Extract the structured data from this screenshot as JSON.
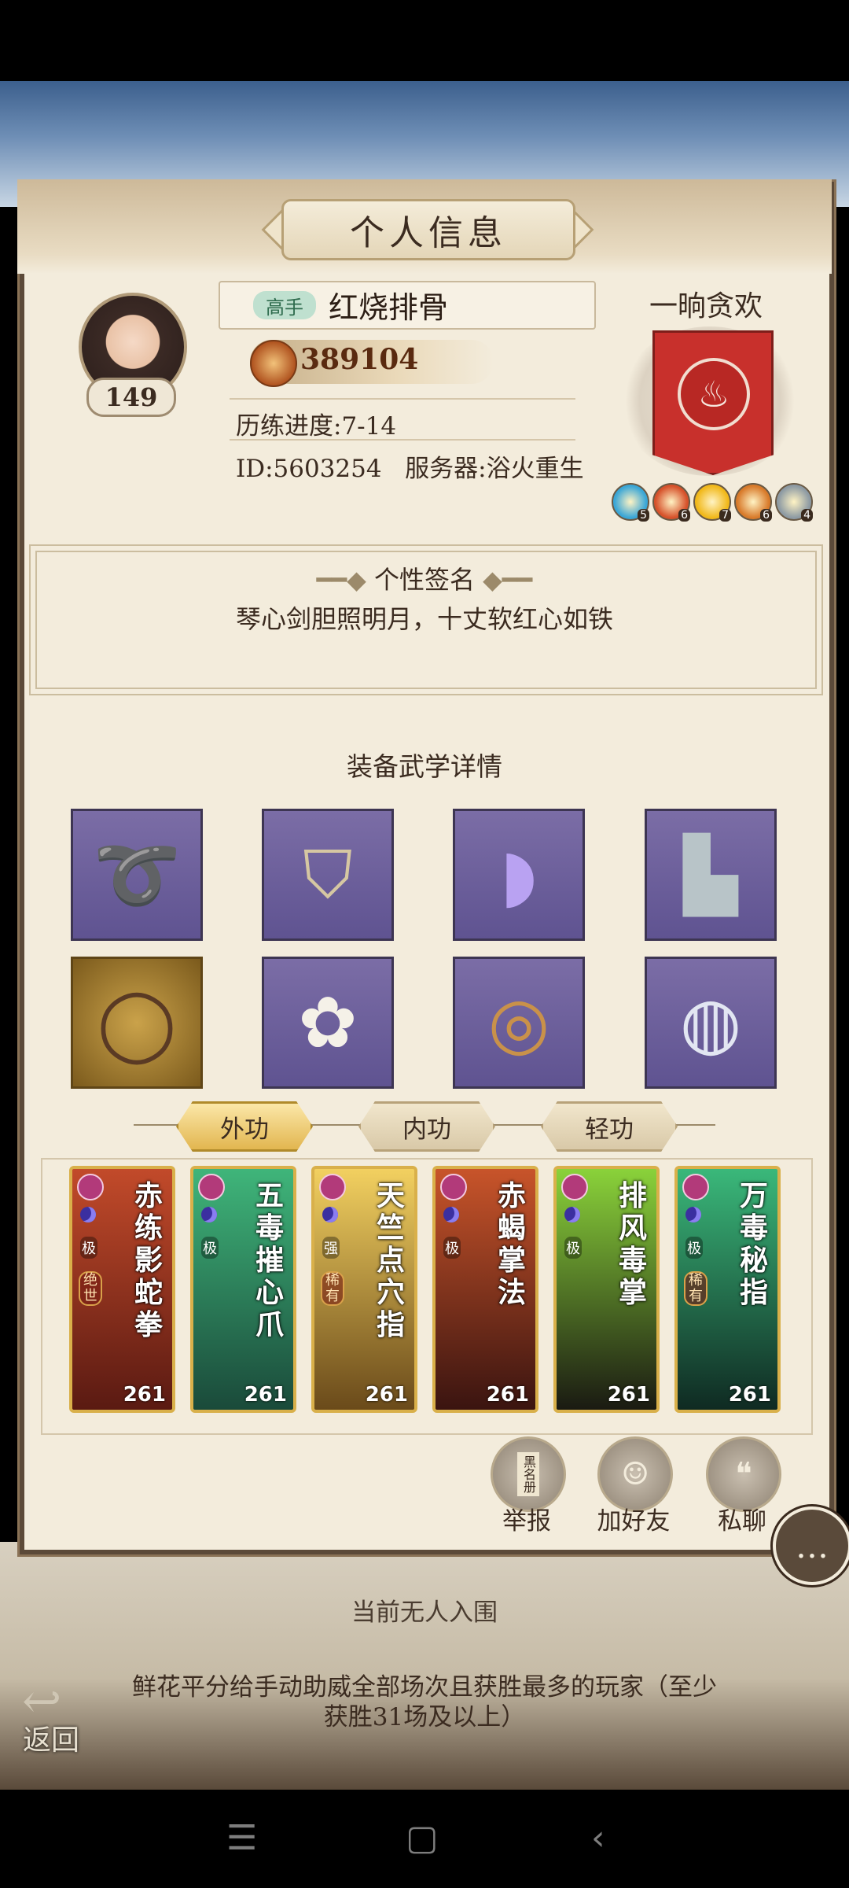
{
  "header": {
    "title": "个人信息"
  },
  "player": {
    "level": "149",
    "rank_tag": "高手",
    "name": "红烧排骨",
    "power": "389104",
    "progress": "历练进度:7-14",
    "id_server": "ID:5603254   服务器:浴火重生"
  },
  "guild": {
    "name": "一晌贪欢",
    "elements": [
      {
        "icon": "wind-element-icon",
        "count": "5",
        "color": "#3aa6d6"
      },
      {
        "icon": "fire-element-icon",
        "count": "6",
        "color": "#d6512a"
      },
      {
        "icon": "sun-element-icon",
        "count": "7",
        "color": "#f1b81a"
      },
      {
        "icon": "flame-element-icon",
        "count": "6",
        "color": "#d87a2a"
      },
      {
        "icon": "metal-element-icon",
        "count": "4",
        "color": "#8d9aa3"
      }
    ]
  },
  "signature": {
    "title": "个性签名",
    "text": "琴心剑胆照明月，十丈软红心如铁"
  },
  "equipment": {
    "title": "装备武学详情"
  },
  "tabs": [
    {
      "label": "外功"
    },
    {
      "label": "内功"
    },
    {
      "label": "轻功"
    }
  ],
  "skills": [
    {
      "name": "赤练影蛇拳",
      "level": "261",
      "rarity": "极",
      "tag": "绝世"
    },
    {
      "name": "五毒摧心爪",
      "level": "261",
      "rarity": "极",
      "tag": ""
    },
    {
      "name": "天竺点穴指",
      "level": "261",
      "rarity": "强",
      "tag": "稀有"
    },
    {
      "name": "赤蝎掌法",
      "level": "261",
      "rarity": "极",
      "tag": ""
    },
    {
      "name": "排风毒掌",
      "level": "261",
      "rarity": "极",
      "tag": ""
    },
    {
      "name": "万毒秘指",
      "level": "261",
      "rarity": "极",
      "tag": "稀有"
    }
  ],
  "actions": {
    "report": "举报",
    "report_book": "黑名册",
    "add_friend": "加好友",
    "private_chat": "私聊"
  },
  "footer": {
    "empty_text": "当前无人入围",
    "flower_note": "鲜花平分给手动助威全部场次且获胜最多的玩家（至少获胜31场及以上）",
    "back": "返回"
  }
}
